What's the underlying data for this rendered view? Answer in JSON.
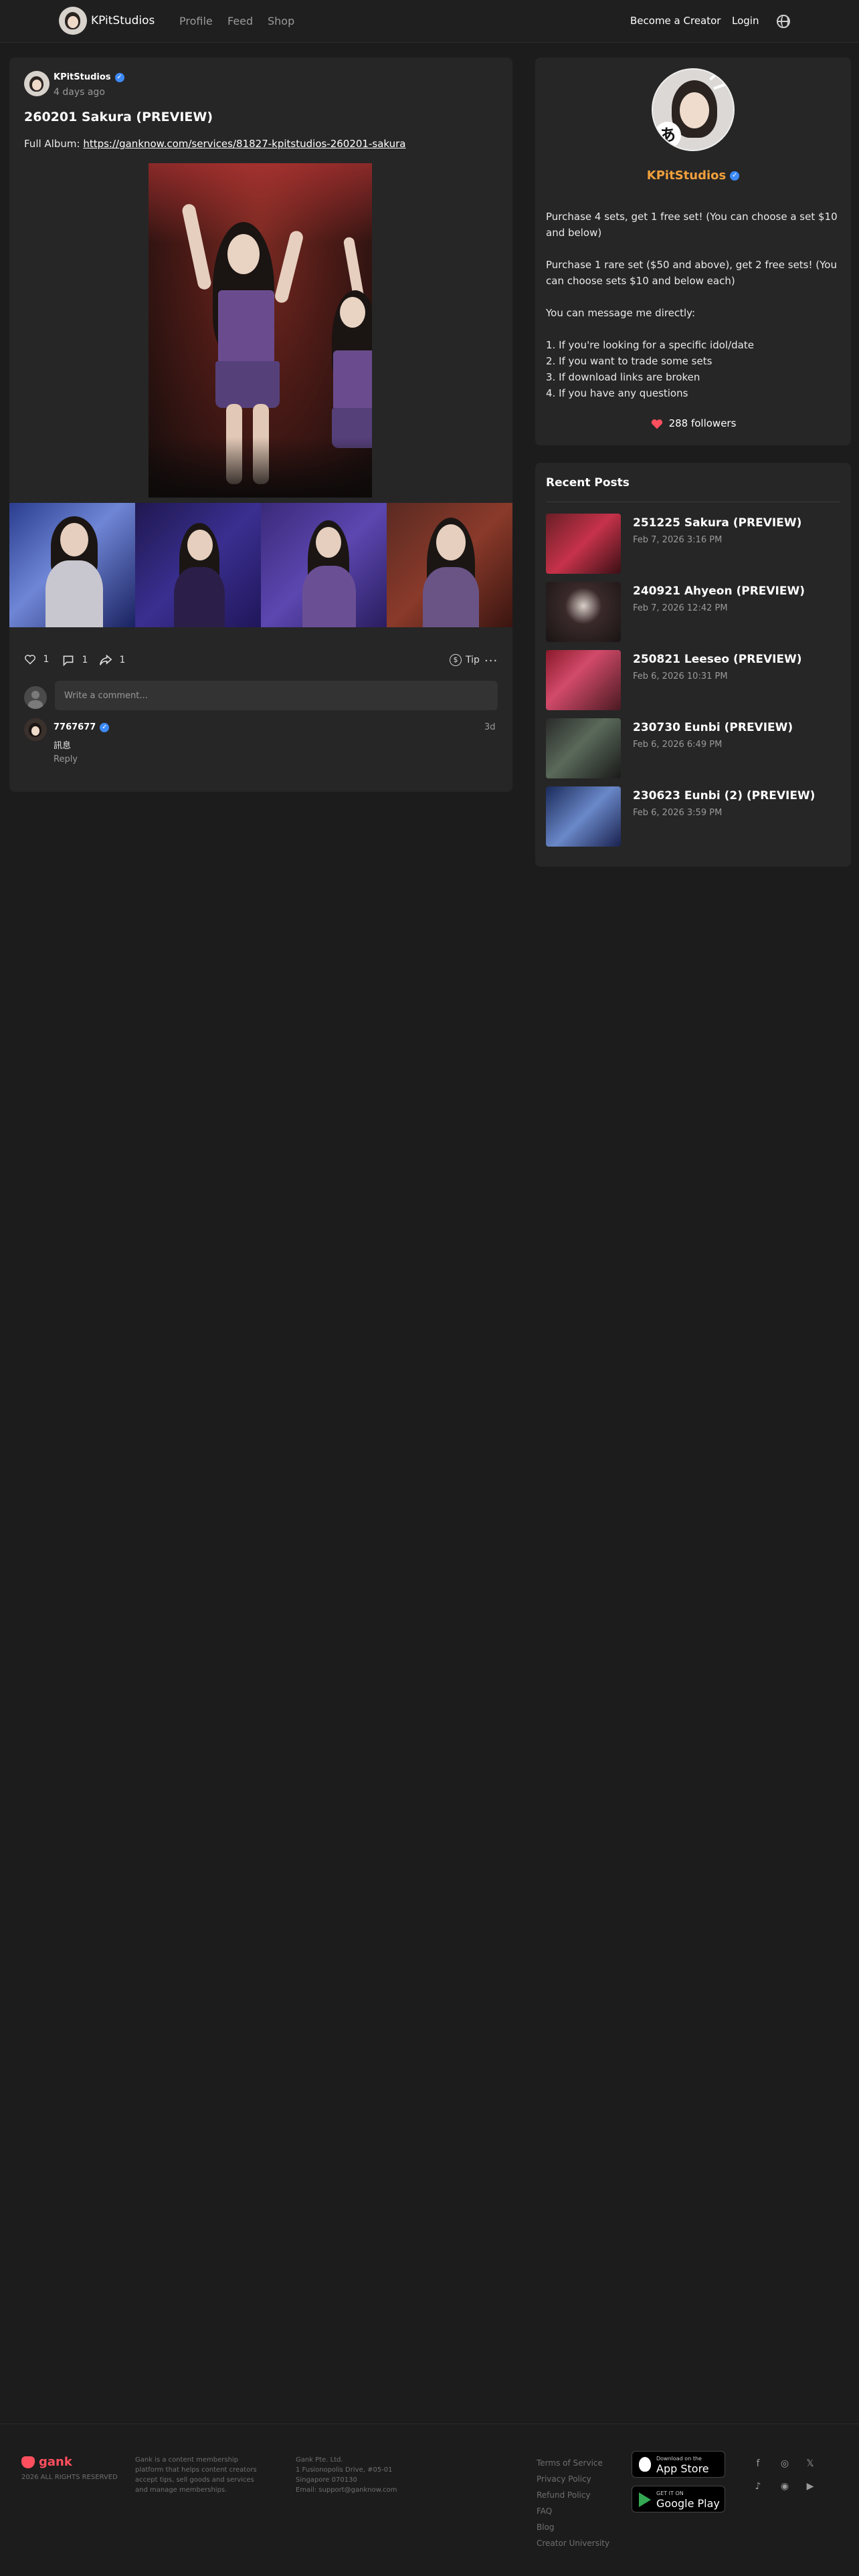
{
  "header": {
    "site_name": "KPitStudios",
    "nav": [
      "Profile",
      "Feed",
      "Shop"
    ],
    "become_creator": "Become a Creator",
    "login": "Login"
  },
  "post": {
    "author": "KPitStudios",
    "time": "4 days ago",
    "title": "260201 Sakura (PREVIEW)",
    "album_label": "Full Album:",
    "album_link": "https://ganknow.com/services/81827-kpitstudios-260201-sakura",
    "likes": "1",
    "comments": "1",
    "shares": "1",
    "tip_label": "Tip",
    "tip_icon": "$",
    "more_icon": "···",
    "comment_placeholder": "Write a comment..."
  },
  "comment": {
    "author": "7767677",
    "time": "3d",
    "text": "訊息",
    "reply": "Reply"
  },
  "profile": {
    "name": "KPitStudios",
    "avatar_badge": "あ",
    "bio": [
      "Purchase 4 sets, get 1 free set! (You can choose a set $10 and below)",
      "Purchase 1 rare set ($50 and above), get 2 free sets! (You can choose sets $10 and below each)",
      "You can message me directly:"
    ],
    "bio_list": [
      "1. If you're looking for a specific idol/date",
      "2. If you want to trade some sets",
      "3. If download links are broken",
      "4. If you have any questions"
    ],
    "followers": "288 followers"
  },
  "recent": {
    "title": "Recent Posts",
    "items": [
      {
        "name": "251225 Sakura (PREVIEW)",
        "date": "Feb 7, 2026 3:16 PM"
      },
      {
        "name": "240921 Ahyeon (PREVIEW)",
        "date": "Feb 7, 2026 12:42 PM"
      },
      {
        "name": "250821 Leeseo (PREVIEW)",
        "date": "Feb 6, 2026 10:31 PM"
      },
      {
        "name": "230730 Eunbi (PREVIEW)",
        "date": "Feb 6, 2026 6:49 PM"
      },
      {
        "name": "230623 Eunbi (2) (PREVIEW)",
        "date": "Feb 6, 2026 3:59 PM"
      }
    ]
  },
  "footer": {
    "brand": "gank",
    "rights": "2026 ALL RIGHTS RESERVED",
    "about": "Gank is a content membership platform that helps content creators accept tips, sell goods and services and manage memberships.",
    "company": [
      "Gank Pte. Ltd.",
      "1 Fusionopolis Drive, #05-01",
      "Singapore 070130",
      "Email: support@ganknow.com"
    ],
    "links": [
      "Terms of Service",
      "Privacy Policy",
      "Refund Policy",
      "FAQ",
      "Blog",
      "Creator University"
    ],
    "app_store": {
      "small": "Download on the",
      "big": "App Store"
    },
    "google_play": {
      "small": "GET IT ON",
      "big": "Google Play"
    },
    "social_icons": [
      "facebook-icon",
      "instagram-icon",
      "x-icon",
      "tiktok-icon",
      "discord-icon",
      "youtube-icon"
    ]
  },
  "colors": {
    "background": "#1c1c1c",
    "card": "#262626",
    "accent_orange": "#f0a03c",
    "verified_blue": "#3d8af7",
    "heart_red": "#ff4f5e"
  }
}
